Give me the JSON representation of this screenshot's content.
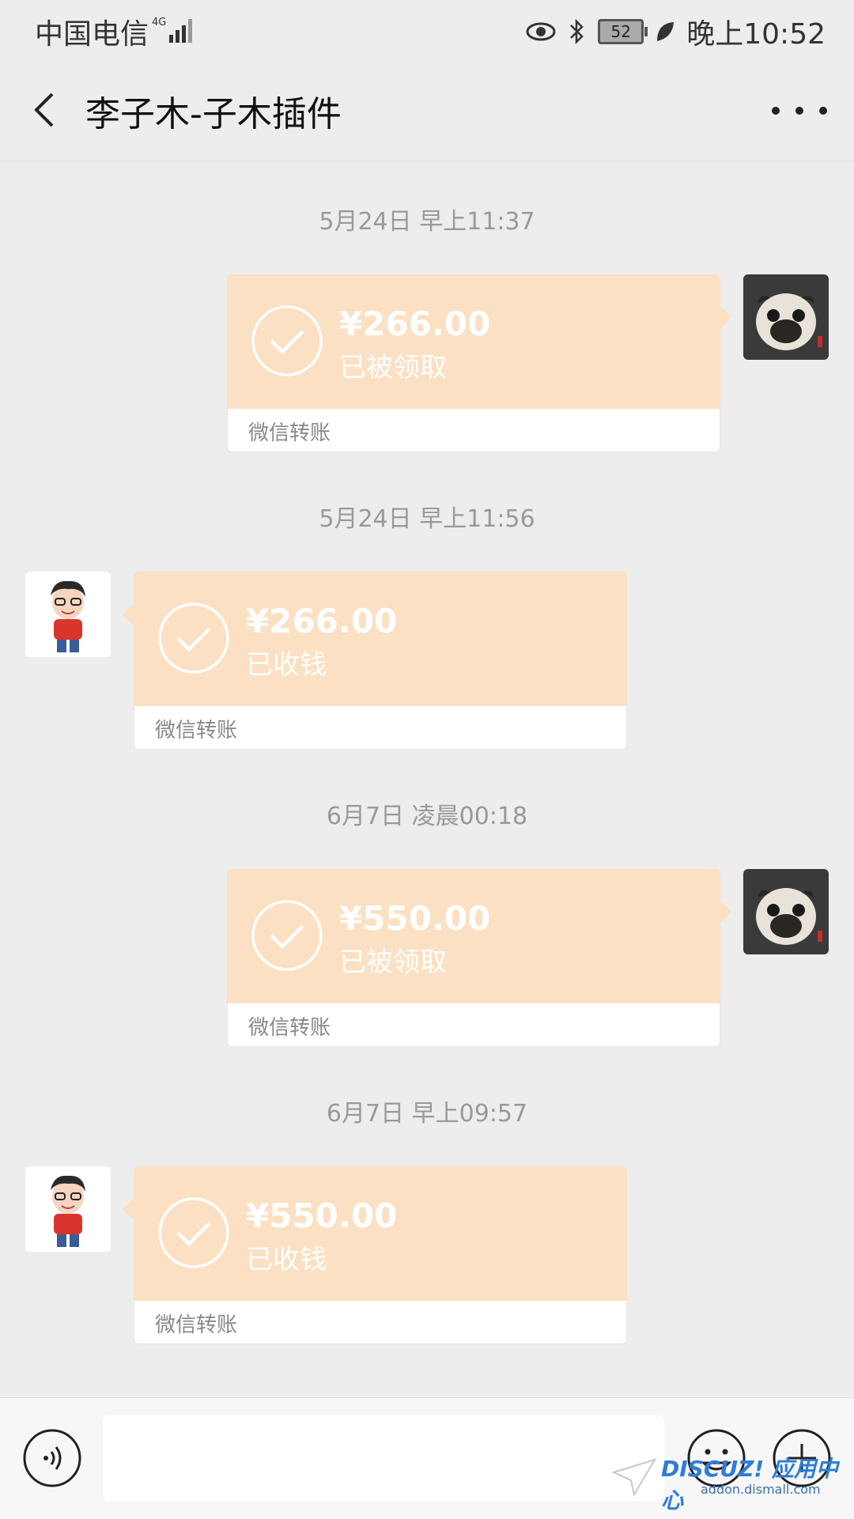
{
  "status_bar": {
    "carrier": "中国电信",
    "network": "4G",
    "battery": "52",
    "time": "晚上10:52"
  },
  "nav": {
    "title": "李子木-子木插件"
  },
  "messages": [
    {
      "timestamp": "5月24日 早上11:37",
      "side": "right",
      "amount": "¥266.00",
      "status": "已被领取",
      "footer": "微信转账"
    },
    {
      "timestamp": "5月24日 早上11:56",
      "side": "left",
      "amount": "¥266.00",
      "status": "已收钱",
      "footer": "微信转账"
    },
    {
      "timestamp": "6月7日 凌晨00:18",
      "side": "right",
      "amount": "¥550.00",
      "status": "已被领取",
      "footer": "微信转账"
    },
    {
      "timestamp": "6月7日 早上09:57",
      "side": "left",
      "amount": "¥550.00",
      "status": "已收钱",
      "footer": "微信转账"
    }
  ],
  "watermark": {
    "brand": "DISCUZ! 应用中心",
    "url": "addon.dismall.com"
  },
  "colors": {
    "background": "#ededed",
    "bubble": "#fbe0c3"
  }
}
